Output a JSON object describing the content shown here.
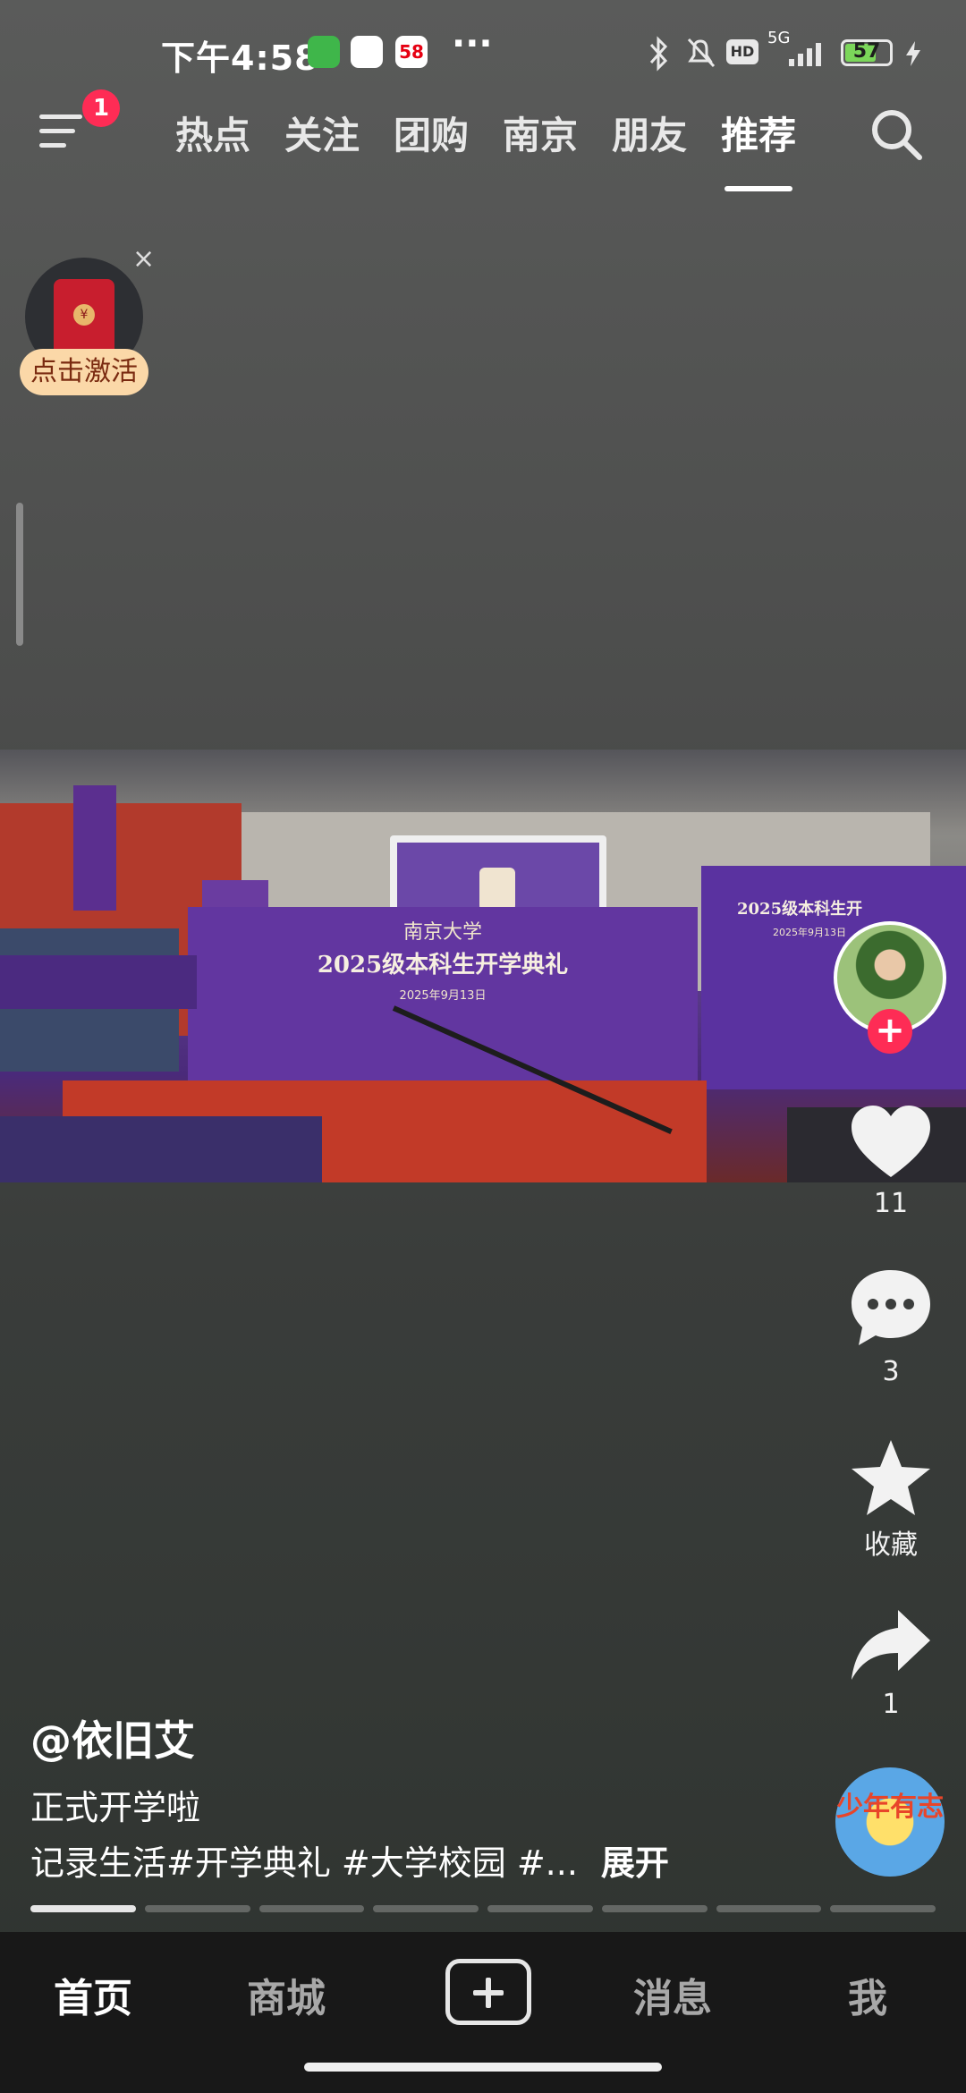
{
  "status_bar": {
    "time": "下午4:58",
    "app_badge_58": "58",
    "more": "···",
    "network": "5G",
    "hd": "HD",
    "battery": "57"
  },
  "top_nav": {
    "notification_count": "1",
    "tabs": [
      "热点",
      "关注",
      "团购",
      "南京",
      "朋友",
      "推荐"
    ],
    "active_tab": "推荐"
  },
  "promo": {
    "label": "点击激活",
    "close": "×"
  },
  "video": {
    "banner_university": "南京大学",
    "banner_title": "2025级本科生开学典礼",
    "banner_date": "2025年9月13日",
    "side_banner_title": "2025级本科生开",
    "side_banner_date": "2025年9月13日"
  },
  "actions": {
    "likes": "11",
    "comments": "3",
    "favorite_label": "收藏",
    "shares": "1"
  },
  "caption": {
    "author": "@依旧艾",
    "line1": "正式开学啦",
    "line2": "记录生活#开学典礼 #大学校园 #...",
    "expand": "展开"
  },
  "mini_badge": {
    "text": "少年有志"
  },
  "progress": {
    "segments": 8,
    "current": 1
  },
  "bottom_nav": {
    "home": "首页",
    "mall": "商城",
    "messages": "消息",
    "me": "我"
  }
}
